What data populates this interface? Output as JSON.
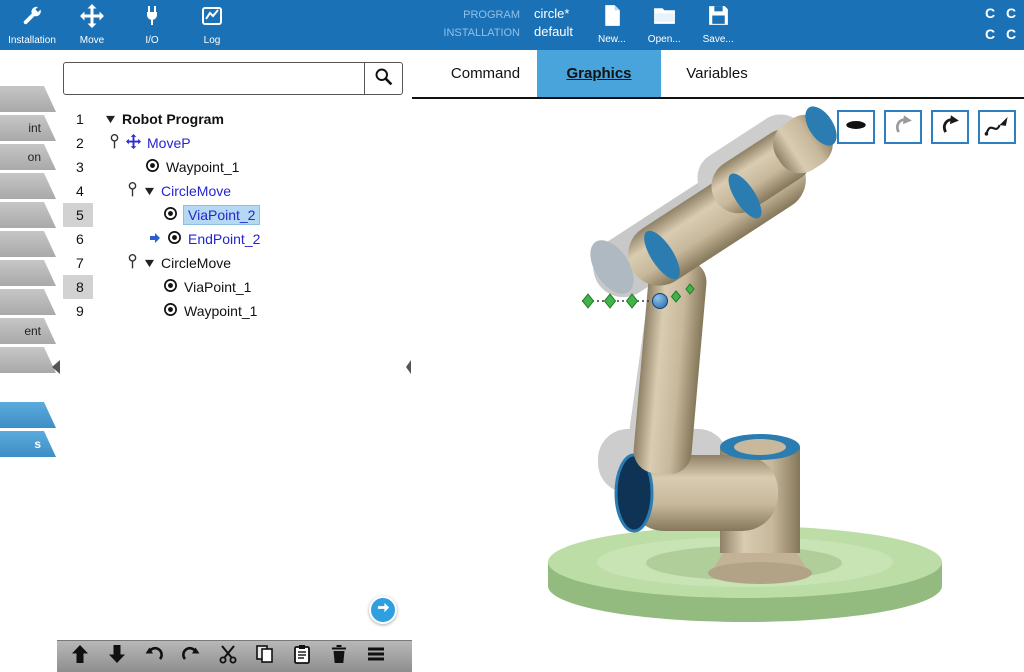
{
  "header": {
    "nav": [
      {
        "label": "Installation",
        "icon": "installation-icon"
      },
      {
        "label": "Move",
        "icon": "move-icon"
      },
      {
        "label": "I/O",
        "icon": "io-icon"
      },
      {
        "label": "Log",
        "icon": "log-icon"
      }
    ],
    "program_label": "PROGRAM",
    "program_value": "circle*",
    "installation_label": "INSTALLATION",
    "installation_value": "default",
    "file_actions": [
      {
        "label": "New...",
        "icon": "new-file-icon"
      },
      {
        "label": "Open...",
        "icon": "open-file-icon"
      },
      {
        "label": "Save...",
        "icon": "save-file-icon"
      }
    ],
    "corner_letters": [
      "C",
      "C",
      "C",
      "C"
    ]
  },
  "left_strip": {
    "tabs": [
      {
        "label": "",
        "active": false
      },
      {
        "label": "int",
        "active": false
      },
      {
        "label": "on",
        "active": false
      },
      {
        "label": "",
        "active": false
      },
      {
        "label": "",
        "active": false
      },
      {
        "label": "",
        "active": false
      },
      {
        "label": "",
        "active": false
      },
      {
        "label": "",
        "active": false
      },
      {
        "label": "ent",
        "active": false
      },
      {
        "label": "",
        "active": false
      },
      {
        "label": "",
        "active": true
      },
      {
        "label": "s",
        "active": true
      }
    ]
  },
  "search": {
    "value": ""
  },
  "tree": {
    "rows": [
      {
        "num": "1",
        "label": "Robot Program"
      },
      {
        "num": "2",
        "label": "MoveP"
      },
      {
        "num": "3",
        "label": "Waypoint_1"
      },
      {
        "num": "4",
        "label": "CircleMove"
      },
      {
        "num": "5",
        "label": "ViaPoint_2"
      },
      {
        "num": "6",
        "label": "EndPoint_2"
      },
      {
        "num": "7",
        "label": "CircleMove"
      },
      {
        "num": "8",
        "label": "ViaPoint_1"
      },
      {
        "num": "9",
        "label": "Waypoint_1"
      }
    ],
    "selected_row": "5"
  },
  "right_tabs": [
    {
      "label": "Command"
    },
    {
      "label": "Graphics"
    },
    {
      "label": "Variables"
    }
  ],
  "toolbar": {
    "buttons": [
      "move-up-icon",
      "move-down-icon",
      "undo-icon",
      "redo-icon",
      "cut-icon",
      "copy-icon",
      "paste-icon",
      "delete-icon",
      "suppress-icon"
    ]
  },
  "view_buttons": [
    "flat-view-icon",
    "rotate-view-secondary-icon",
    "rotate-view-icon",
    "trajectory-view-icon"
  ],
  "colors": {
    "topbar": "#1b71b5",
    "tab_active": "#48a4da",
    "selection": "#b5d9f2",
    "link_blue": "#2525d0",
    "base_green": "#bcdda6",
    "robot_tan": "#c7b89b",
    "joint_blue": "#2b7cb0"
  }
}
